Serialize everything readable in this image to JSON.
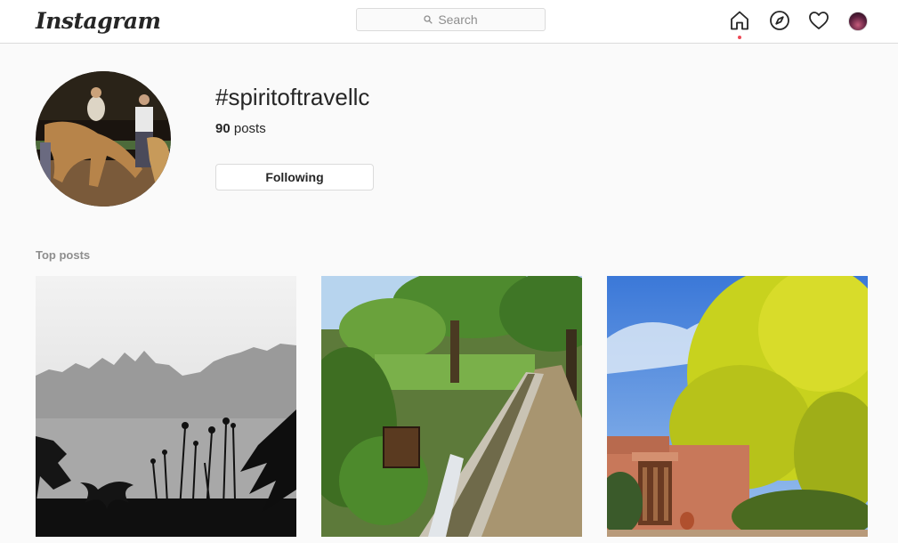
{
  "header": {
    "logo_text": "Instagram",
    "search_placeholder": "Search",
    "icons": [
      "home-icon",
      "explore-compass-icon",
      "activity-heart-icon",
      "profile-avatar"
    ],
    "accent_dot_color": "#ed4956"
  },
  "tag": {
    "title": "#spiritoftravellc",
    "posts_count": "90",
    "posts_label": "posts",
    "follow_label": "Following"
  },
  "top_posts": {
    "heading": "Top posts",
    "items": [
      {
        "description_icon": "mountain-silhouette-photo"
      },
      {
        "description_icon": "irrigation-canal-photo"
      },
      {
        "description_icon": "adobe-house-yellow-tree-photo"
      }
    ]
  }
}
